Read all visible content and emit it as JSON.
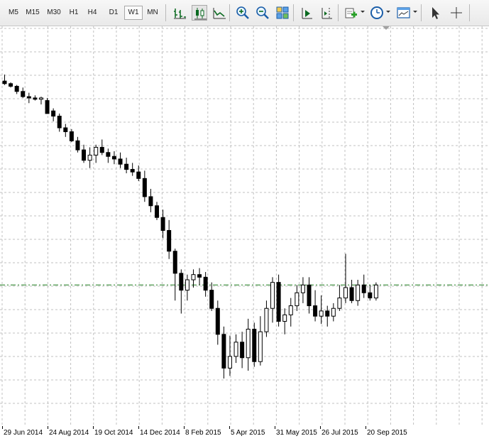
{
  "toolbar": {
    "timeframes": [
      {
        "label": "M5",
        "active": false
      },
      {
        "label": "M15",
        "active": false
      },
      {
        "label": "M30",
        "active": false
      },
      {
        "label": "H1",
        "active": false
      },
      {
        "label": "H4",
        "active": false
      },
      {
        "label": "D1",
        "active": false
      },
      {
        "label": "W1",
        "active": true
      },
      {
        "label": "MN",
        "active": false
      }
    ],
    "buttons": [
      {
        "name": "bar-chart",
        "icon": "bar-chart-icon",
        "pressed": false
      },
      {
        "name": "candlestick-chart",
        "icon": "candlestick-icon",
        "pressed": true
      },
      {
        "name": "line-chart",
        "icon": "line-chart-icon",
        "pressed": false
      },
      {
        "name": "zoom-in",
        "icon": "zoom-in-icon",
        "pressed": false
      },
      {
        "name": "zoom-out",
        "icon": "zoom-out-icon",
        "pressed": false
      },
      {
        "name": "tile-windows",
        "icon": "tile-windows-icon",
        "pressed": false
      },
      {
        "name": "auto-scroll",
        "icon": "auto-scroll-icon",
        "pressed": false
      },
      {
        "name": "chart-shift",
        "icon": "chart-shift-icon",
        "pressed": false
      },
      {
        "name": "indicators",
        "icon": "add-indicator-icon",
        "pressed": false,
        "dropdown": true
      },
      {
        "name": "periodicity",
        "icon": "clock-icon",
        "pressed": false,
        "dropdown": true
      },
      {
        "name": "templates",
        "icon": "template-icon",
        "pressed": false,
        "dropdown": true
      },
      {
        "name": "cursor",
        "icon": "cursor-arrow-icon",
        "pressed": false
      },
      {
        "name": "crosshair",
        "icon": "crosshair-icon",
        "pressed": false
      }
    ]
  },
  "colors": {
    "grid": "#c0c0c0",
    "candle_line": "#000000",
    "bull_body": "#ffffff",
    "bear_body": "#000000",
    "price_line": "#1a7a1a",
    "toolbar_bg": "#ececec"
  },
  "chart_data": {
    "type": "candlestick",
    "timeframe": "W1",
    "current_price_line": true,
    "xaxis_labels": [
      "29 Jun 2014",
      "24 Aug 2014",
      "19 Oct 2014",
      "14 Dec 2014",
      "8 Feb 2015",
      "5 Apr 2015",
      "31 May 2015",
      "26 Jul 2015",
      "20 Sep 2015"
    ],
    "candles": [
      {
        "o": 91,
        "h": 96,
        "l": 88,
        "c": 89
      },
      {
        "o": 89,
        "h": 90,
        "l": 86,
        "c": 87
      },
      {
        "o": 87,
        "h": 88,
        "l": 81,
        "c": 83
      },
      {
        "o": 83,
        "h": 86,
        "l": 78,
        "c": 79
      },
      {
        "o": 79,
        "h": 82,
        "l": 74,
        "c": 78
      },
      {
        "o": 78,
        "h": 80,
        "l": 76,
        "c": 77
      },
      {
        "o": 77,
        "h": 79,
        "l": 73,
        "c": 78
      },
      {
        "o": 76,
        "h": 78,
        "l": 68,
        "c": 66
      },
      {
        "o": 68,
        "h": 70,
        "l": 60,
        "c": 64
      },
      {
        "o": 64,
        "h": 66,
        "l": 52,
        "c": 55
      },
      {
        "o": 55,
        "h": 58,
        "l": 48,
        "c": 52
      },
      {
        "o": 52,
        "h": 54,
        "l": 44,
        "c": 45
      },
      {
        "o": 45,
        "h": 48,
        "l": 36,
        "c": 38
      },
      {
        "o": 38,
        "h": 42,
        "l": 28,
        "c": 30
      },
      {
        "o": 30,
        "h": 40,
        "l": 24,
        "c": 34
      },
      {
        "o": 34,
        "h": 42,
        "l": 28,
        "c": 40
      },
      {
        "o": 40,
        "h": 46,
        "l": 34,
        "c": 36
      },
      {
        "o": 36,
        "h": 39,
        "l": 28,
        "c": 33
      },
      {
        "o": 33,
        "h": 37,
        "l": 27,
        "c": 31
      },
      {
        "o": 31,
        "h": 36,
        "l": 24,
        "c": 27
      },
      {
        "o": 27,
        "h": 32,
        "l": 20,
        "c": 23
      },
      {
        "o": 23,
        "h": 28,
        "l": 18,
        "c": 21
      },
      {
        "o": 21,
        "h": 26,
        "l": 14,
        "c": 16
      },
      {
        "o": 16,
        "h": 22,
        "l": -2,
        "c": 2
      },
      {
        "o": 2,
        "h": 8,
        "l": -10,
        "c": -5
      },
      {
        "o": -5,
        "h": -2,
        "l": -16,
        "c": -14
      },
      {
        "o": -14,
        "h": -8,
        "l": -30,
        "c": -24
      },
      {
        "o": -24,
        "h": -16,
        "l": -46,
        "c": -40
      },
      {
        "o": -40,
        "h": -38,
        "l": -78,
        "c": -57
      },
      {
        "o": -57,
        "h": -54,
        "l": -88,
        "c": -70
      },
      {
        "o": -70,
        "h": -58,
        "l": -78,
        "c": -62
      },
      {
        "o": -62,
        "h": -54,
        "l": -68,
        "c": -58
      },
      {
        "o": -58,
        "h": -53,
        "l": -66,
        "c": -60
      },
      {
        "o": -60,
        "h": -56,
        "l": -75,
        "c": -70
      },
      {
        "o": -70,
        "h": -64,
        "l": -86,
        "c": -84
      },
      {
        "o": -84,
        "h": -78,
        "l": -112,
        "c": -104
      },
      {
        "o": -104,
        "h": -98,
        "l": -138,
        "c": -130
      },
      {
        "o": -130,
        "h": -105,
        "l": -136,
        "c": -121
      },
      {
        "o": -121,
        "h": -104,
        "l": -126,
        "c": -110
      },
      {
        "o": -110,
        "h": -102,
        "l": -130,
        "c": -122
      },
      {
        "o": -122,
        "h": -92,
        "l": -132,
        "c": -100
      },
      {
        "o": -100,
        "h": -95,
        "l": -129,
        "c": -125
      },
      {
        "o": -125,
        "h": -90,
        "l": -128,
        "c": -102
      },
      {
        "o": -102,
        "h": -78,
        "l": -106,
        "c": -84
      },
      {
        "o": -84,
        "h": -60,
        "l": -95,
        "c": -64
      },
      {
        "o": -64,
        "h": -58,
        "l": -98,
        "c": -94
      },
      {
        "o": -94,
        "h": -84,
        "l": -104,
        "c": -89
      },
      {
        "o": -89,
        "h": -76,
        "l": -98,
        "c": -82
      },
      {
        "o": -82,
        "h": -66,
        "l": -86,
        "c": -72
      },
      {
        "o": -72,
        "h": -60,
        "l": -80,
        "c": -66
      },
      {
        "o": -66,
        "h": -60,
        "l": -88,
        "c": -82
      },
      {
        "o": -82,
        "h": -70,
        "l": -94,
        "c": -90
      },
      {
        "o": -90,
        "h": -74,
        "l": -96,
        "c": -86
      },
      {
        "o": -86,
        "h": -82,
        "l": -98,
        "c": -90
      },
      {
        "o": -90,
        "h": -80,
        "l": -94,
        "c": -84
      },
      {
        "o": -84,
        "h": -66,
        "l": -86,
        "c": -76
      },
      {
        "o": -76,
        "h": -42,
        "l": -80,
        "c": -68
      },
      {
        "o": -68,
        "h": -62,
        "l": -80,
        "c": -78
      },
      {
        "o": -78,
        "h": -62,
        "l": -82,
        "c": -66
      },
      {
        "o": -66,
        "h": -58,
        "l": -76,
        "c": -72
      },
      {
        "o": -72,
        "h": -66,
        "l": -78,
        "c": -76
      },
      {
        "o": -76,
        "h": -64,
        "l": -78,
        "c": -66
      }
    ]
  }
}
